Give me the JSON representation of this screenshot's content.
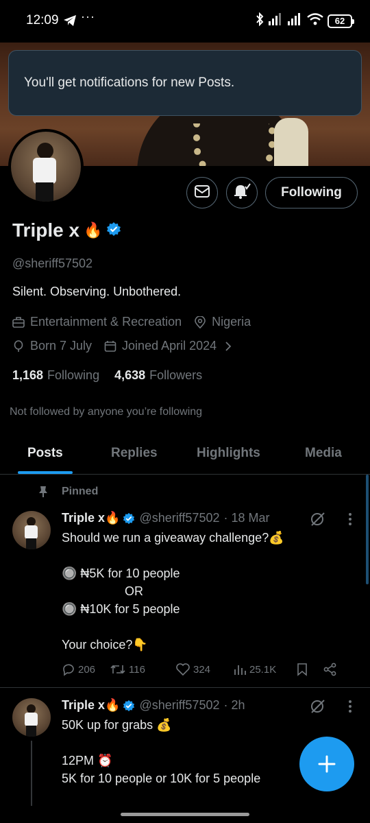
{
  "status_bar": {
    "time": "12:09",
    "dots": "···",
    "battery": "62"
  },
  "toast": {
    "message": "You'll get notifications for new Posts."
  },
  "profile": {
    "display_name": "Triple x",
    "name_emoji": "🔥",
    "handle": "@sheriff57502",
    "bio": "Silent. Observing. Unbothered.",
    "category": "Entertainment & Recreation",
    "location": "Nigeria",
    "born": "Born 7 July",
    "joined": "Joined April 2024",
    "following_count": "1,168",
    "following_label": "Following",
    "followers_count": "4,638",
    "followers_label": "Followers",
    "not_followed": "Not followed by anyone you’re following",
    "follow_button": "Following"
  },
  "tabs": [
    {
      "label": "Posts",
      "active": true
    },
    {
      "label": "Replies",
      "active": false
    },
    {
      "label": "Highlights",
      "active": false
    },
    {
      "label": "Media",
      "active": false
    }
  ],
  "posts": [
    {
      "pinned_label": "Pinned",
      "name": "Triple x",
      "name_emoji": "🔥",
      "handle": "@sheriff57502",
      "time": "· 18 Mar",
      "lines": [
        "Should we run a giveaway challenge?💰",
        "",
        "🔘 ₦5K for 10 people",
        "OR",
        "🔘 ₦10K for 5 people",
        "",
        "Your choice?👇"
      ],
      "replies": "206",
      "reposts": "116",
      "likes": "324",
      "views": "25.1K"
    },
    {
      "name": "Triple x",
      "name_emoji": "🔥",
      "handle": "@sheriff57502",
      "time": "· 2h",
      "lines": [
        "50K up for grabs 💰",
        "",
        "12PM ⏰",
        "5K for 10 people or 10K for 5 people"
      ]
    }
  ],
  "colors": {
    "accent": "#1d9bf0",
    "muted": "#71767b",
    "text": "#e7e9ea",
    "background": "#000000"
  },
  "icons": [
    "telegram-icon",
    "bluetooth-icon",
    "signal-icon",
    "wifi-icon",
    "battery-icon",
    "mail-icon",
    "bell-icon",
    "verified-icon",
    "briefcase-icon",
    "location-icon",
    "balloon-icon",
    "calendar-icon",
    "chevron-right-icon",
    "pin-icon",
    "grok-icon",
    "more-icon",
    "reply-icon",
    "repost-icon",
    "like-icon",
    "views-icon",
    "bookmark-icon",
    "share-icon",
    "plus-icon"
  ]
}
